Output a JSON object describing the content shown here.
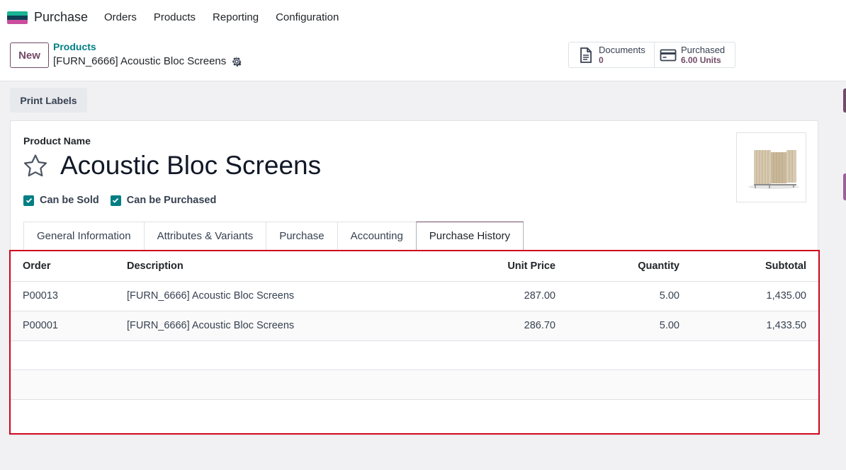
{
  "app": {
    "name": "Purchase",
    "logo_colors": [
      "#1ab394",
      "#0f3e54",
      "#c94e9d"
    ],
    "menu": [
      "Orders",
      "Products",
      "Reporting",
      "Configuration"
    ]
  },
  "control_panel": {
    "new_label": "New",
    "breadcrumb_parent": "Products",
    "breadcrumb_current": "[FURN_6666] Acoustic Bloc Screens",
    "smart_buttons": {
      "documents": {
        "label": "Documents",
        "value": "0",
        "icon": "document-icon"
      },
      "purchased": {
        "label": "Purchased",
        "value": "6.00 Units",
        "icon": "credit-card-icon"
      }
    }
  },
  "actions": {
    "print_labels": "Print Labels"
  },
  "form": {
    "product_name_label": "Product Name",
    "product_name": "Acoustic Bloc Screens",
    "checkboxes": {
      "can_be_sold": "Can be Sold",
      "can_be_purchased": "Can be Purchased"
    },
    "tabs": [
      "General Information",
      "Attributes & Variants",
      "Purchase",
      "Accounting",
      "Purchase History"
    ],
    "active_tab": "Purchase History"
  },
  "history": {
    "columns": {
      "order": "Order",
      "description": "Description",
      "unit_price": "Unit Price",
      "quantity": "Quantity",
      "subtotal": "Subtotal"
    },
    "rows": [
      {
        "order": "P00013",
        "description": "[FURN_6666] Acoustic Bloc Screens",
        "unit_price": "287.00",
        "quantity": "5.00",
        "subtotal": "1,435.00"
      },
      {
        "order": "P00001",
        "description": "[FURN_6666] Acoustic Bloc Screens",
        "unit_price": "286.70",
        "quantity": "5.00",
        "subtotal": "1,433.50"
      }
    ]
  },
  "colors": {
    "brand": "#714b67",
    "accent": "#017e84",
    "highlight": "#d0021b"
  }
}
